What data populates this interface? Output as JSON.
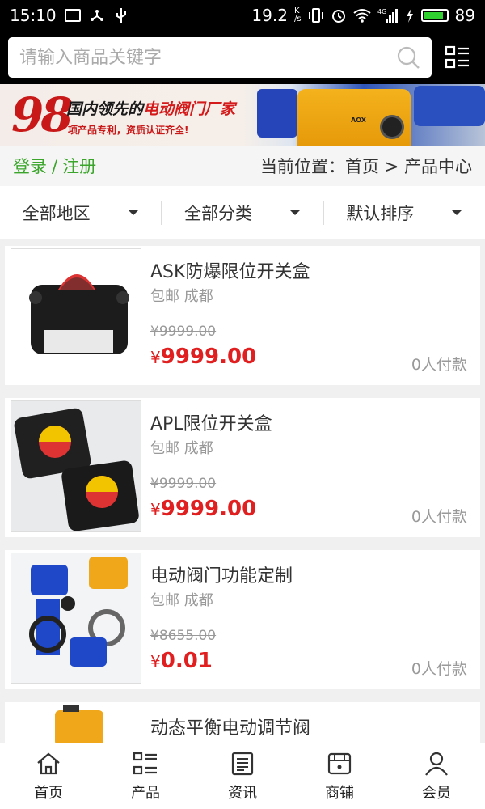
{
  "statusbar": {
    "time": "15:10",
    "speed": "19.2",
    "speed_unit_top": "K",
    "speed_unit_bottom": "/s",
    "network": "4G",
    "battery": "89"
  },
  "search": {
    "placeholder": "请输入商品关键字"
  },
  "banner": {
    "number": "98",
    "title_black": "国内领先的",
    "title_red": "电动阀门厂家",
    "subtitle": "项产品专利，资质认证齐全!",
    "device_label": "AOX"
  },
  "locbar": {
    "login": "登录",
    "separator": "/",
    "register": "注册",
    "breadcrumb": "当前位置：首页 > 产品中心"
  },
  "filters": [
    {
      "label": "全部地区"
    },
    {
      "label": "全部分类"
    },
    {
      "label": "默认排序"
    }
  ],
  "products": [
    {
      "name": "ASK防爆限位开关盒",
      "shipping": "包邮 成都",
      "original_price": "¥9999.00",
      "currency": "¥",
      "price": "9999.00",
      "sold": "0人付款"
    },
    {
      "name": "APL限位开关盒",
      "shipping": "包邮 成都",
      "original_price": "¥9999.00",
      "currency": "¥",
      "price": "9999.00",
      "sold": "0人付款"
    },
    {
      "name": "电动阀门功能定制",
      "shipping": "包邮 成都",
      "original_price": "¥8655.00",
      "currency": "¥",
      "price": "0.01",
      "sold": "0人付款"
    },
    {
      "name": "动态平衡电动调节阀",
      "shipping": "",
      "original_price": "",
      "currency": "",
      "price": "",
      "sold": ""
    }
  ],
  "bottomnav": [
    {
      "label": "首页",
      "icon": "home-icon"
    },
    {
      "label": "产品",
      "icon": "grid-list-icon"
    },
    {
      "label": "资讯",
      "icon": "news-icon"
    },
    {
      "label": "商铺",
      "icon": "shop-icon"
    },
    {
      "label": "会员",
      "icon": "user-icon"
    }
  ],
  "colors": {
    "accent_green": "#3aa52a",
    "price_red": "#e02020",
    "header_bg": "#000000"
  }
}
